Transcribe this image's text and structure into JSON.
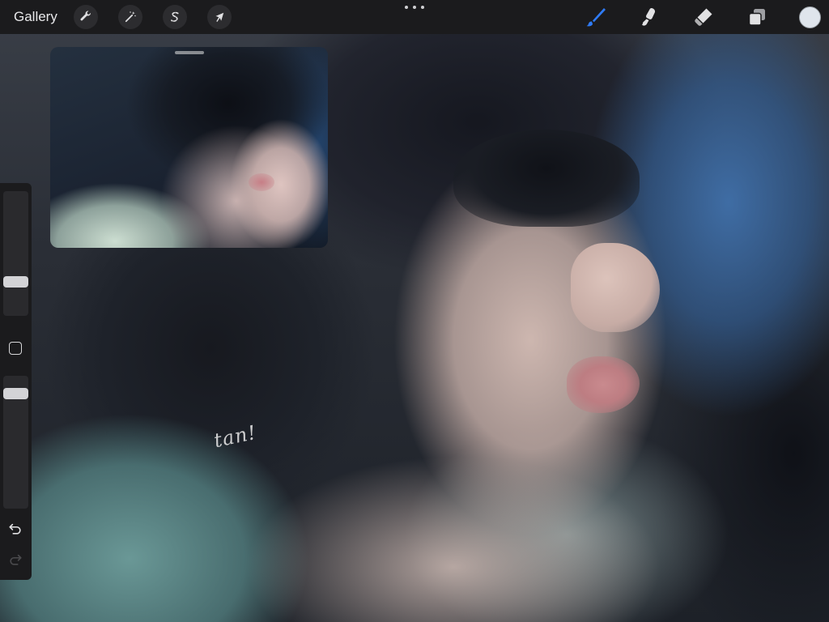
{
  "topbar": {
    "gallery_label": "Gallery",
    "left_tools": [
      {
        "name": "wrench-icon",
        "role": "actions"
      },
      {
        "name": "magic-wand-icon",
        "role": "adjustments"
      },
      {
        "name": "selection-s-icon",
        "role": "selection"
      },
      {
        "name": "arrow-cursor-icon",
        "role": "transform"
      }
    ],
    "right_tools": [
      {
        "name": "brush-icon",
        "role": "paint",
        "active": true
      },
      {
        "name": "smudge-icon",
        "role": "smudge",
        "active": false
      },
      {
        "name": "eraser-icon",
        "role": "erase",
        "active": false
      },
      {
        "name": "layers-icon",
        "role": "layers",
        "active": false
      }
    ],
    "current_color": "#dfe5ec"
  },
  "sidebar": {
    "brush_size_level": 0.25,
    "brush_opacity_level": 0.9
  },
  "canvas": {
    "signature_text": "tan!"
  },
  "colors": {
    "toolbar_bg": "#1b1b1d",
    "active_tool": "#2f7bf6",
    "icon": "#e1e1e3"
  }
}
